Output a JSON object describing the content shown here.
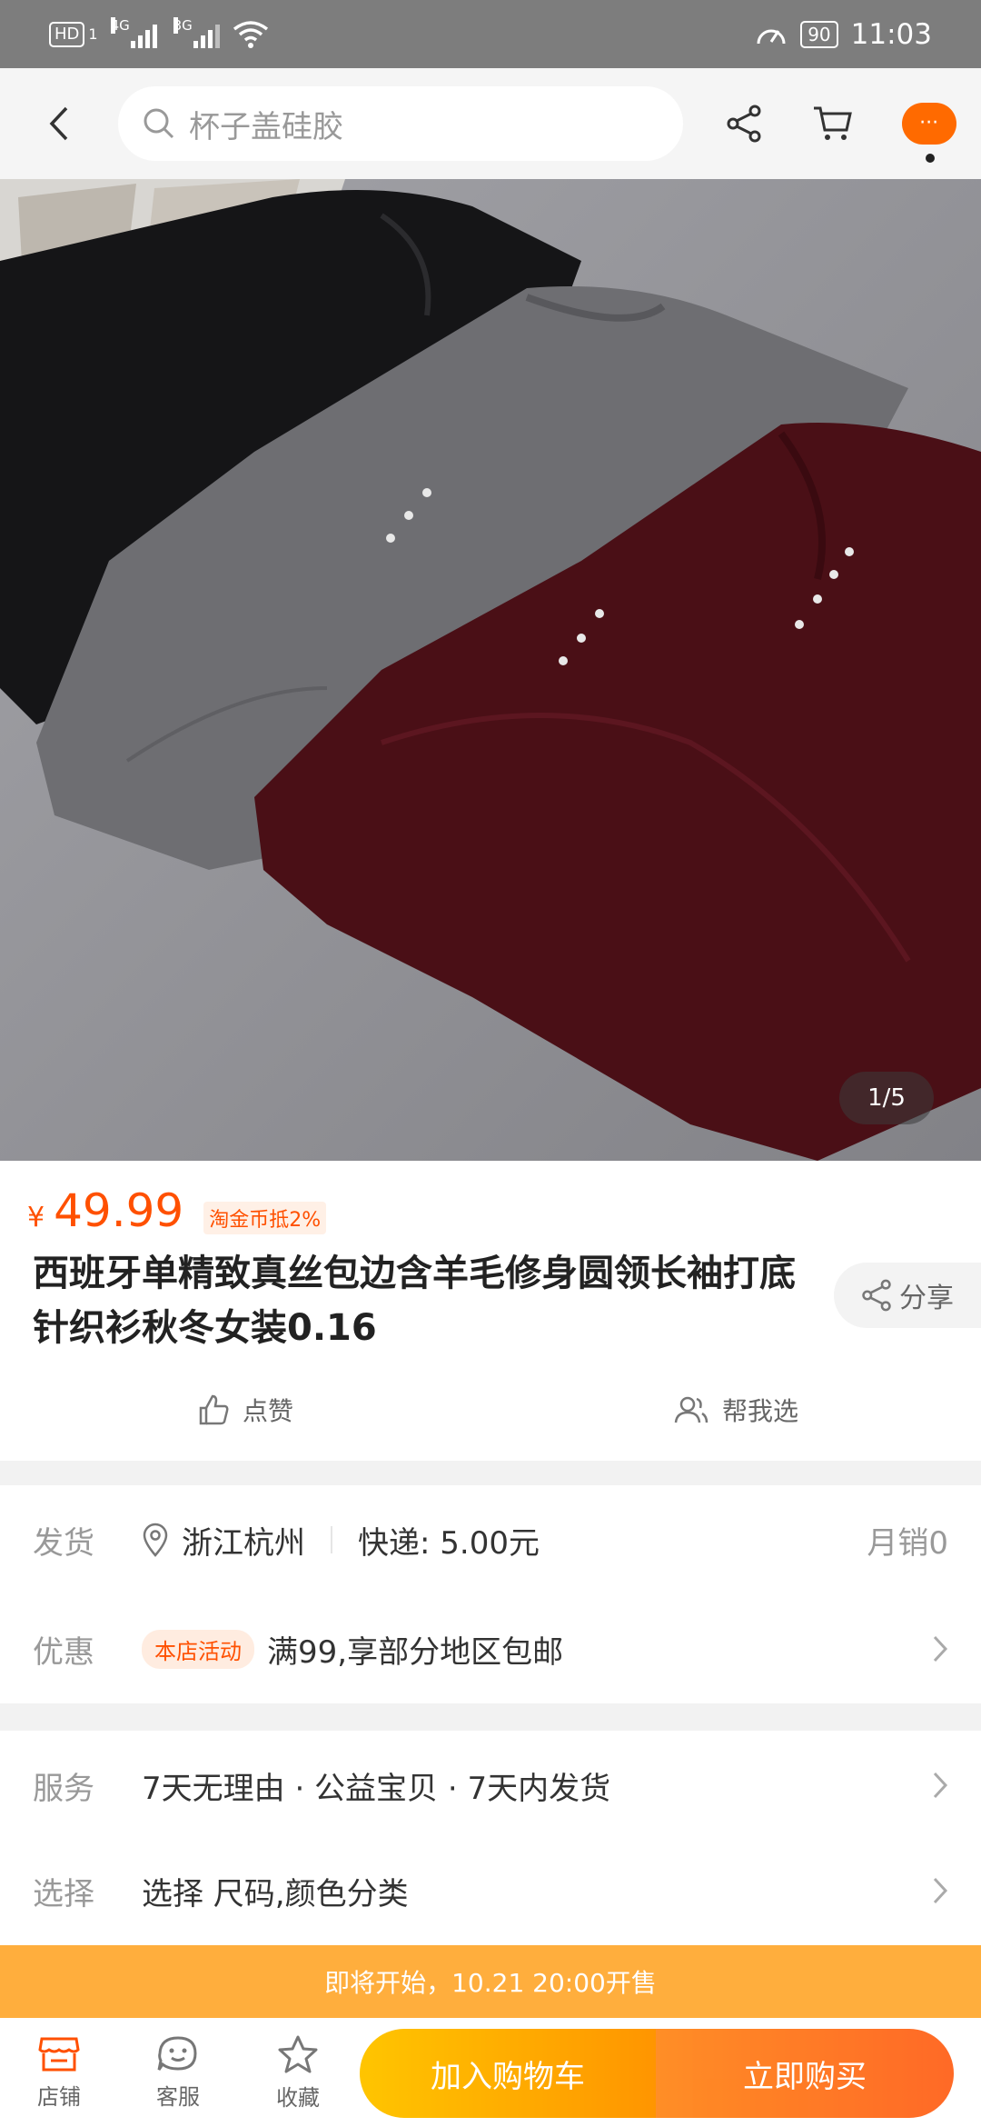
{
  "status_bar": {
    "hd": "HD",
    "sim1": "1",
    "net1": "4G",
    "net2": "3G",
    "battery": "90",
    "time": "11:03"
  },
  "nav": {
    "search_placeholder": "杯子盖硅胶",
    "more_label": "···"
  },
  "product": {
    "image_counter": "1/5",
    "currency": "¥",
    "price": "49.99",
    "coin_tag": "淘金币抵2%",
    "title": "西班牙单精致真丝包边含羊毛修身圆领长袖打底针织衫秋冬女装0.16",
    "share_label": "分享",
    "like_label": "点赞",
    "help_choose_label": "帮我选"
  },
  "delivery": {
    "label": "发货",
    "location": "浙江杭州",
    "shipping": "快递: 5.00元",
    "monthly_sales": "月销0"
  },
  "promotion": {
    "label": "优惠",
    "tag": "本店活动",
    "text": "满99,享部分地区包邮"
  },
  "service": {
    "label": "服务",
    "text": "7天无理由 · 公益宝贝 · 7天内发货"
  },
  "selection": {
    "label": "选择",
    "text": "选择 尺码,颜色分类"
  },
  "banner": {
    "text": "即将开始，10.21 20:00开售"
  },
  "bottom_bar": {
    "shop": "店铺",
    "service": "客服",
    "favorite": "收藏",
    "add_to_cart": "加入购物车",
    "buy_now": "立即购买"
  },
  "colors": {
    "accent": "#ff5000",
    "banner": "#ffae3d",
    "cart_button": "#ffb300",
    "buy_button": "#ff5a00"
  }
}
